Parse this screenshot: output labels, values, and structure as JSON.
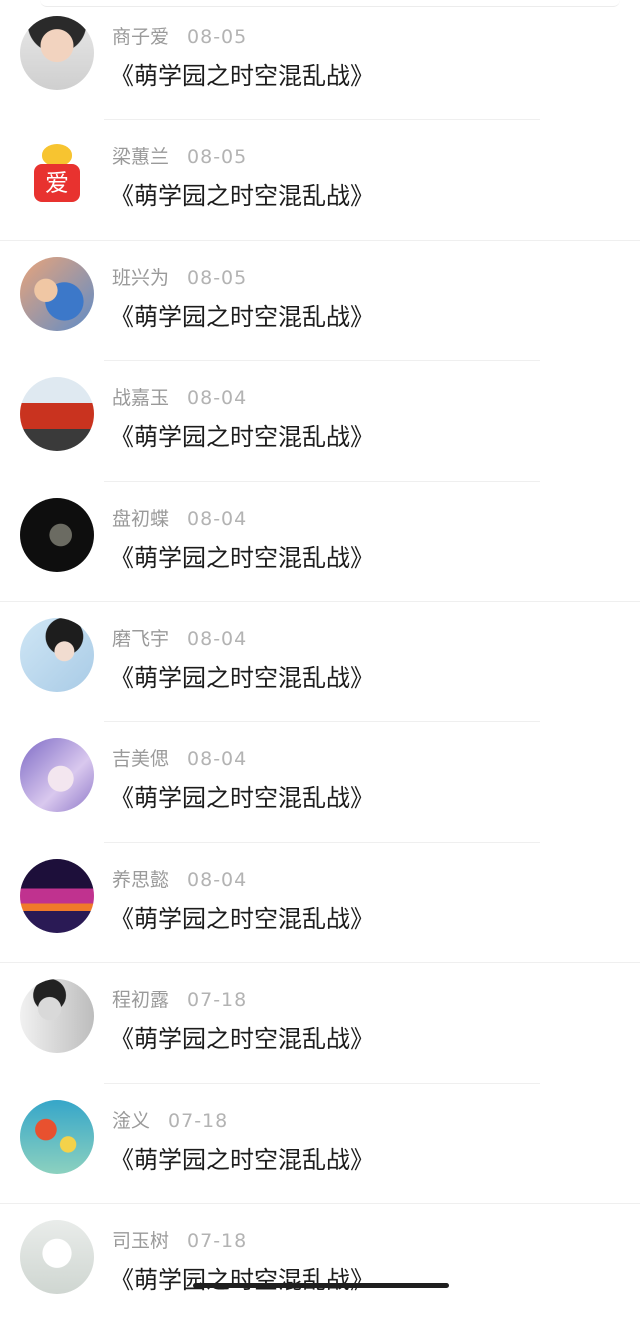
{
  "items": [
    {
      "name": "商子爱",
      "date": "08-05",
      "title": "《萌学园之时空混乱战》",
      "avatar_icon": "avatar-photo-icon"
    },
    {
      "name": "梁蕙兰",
      "date": "08-05",
      "title": "《萌学园之时空混乱战》",
      "avatar_icon": "love-mascot-icon",
      "avatar_text": "爱"
    },
    {
      "name": "班兴为",
      "date": "08-05",
      "title": "《萌学园之时空混乱战》",
      "avatar_icon": "avatar-photo-icon"
    },
    {
      "name": "战嘉玉",
      "date": "08-04",
      "title": "《萌学园之时空混乱战》",
      "avatar_icon": "fire-truck-icon"
    },
    {
      "name": "盘初蝶",
      "date": "08-04",
      "title": "《萌学园之时空混乱战》",
      "avatar_icon": "dinosaur-icon"
    },
    {
      "name": "磨飞宇",
      "date": "08-04",
      "title": "《萌学园之时空混乱战》",
      "avatar_icon": "avatar-photo-icon"
    },
    {
      "name": "吉美偲",
      "date": "08-04",
      "title": "《萌学园之时空混乱战》",
      "avatar_icon": "anime-girl-icon"
    },
    {
      "name": "养思懿",
      "date": "08-04",
      "title": "《萌学园之时空混乱战》",
      "avatar_icon": "city-night-icon"
    },
    {
      "name": "程初露",
      "date": "07-18",
      "title": "《萌学园之时空混乱战》",
      "avatar_icon": "avatar-photo-icon"
    },
    {
      "name": "淦义",
      "date": "07-18",
      "title": "《萌学园之时空混乱战》",
      "avatar_icon": "flowers-icon"
    },
    {
      "name": "司玉树",
      "date": "07-18",
      "title": "《萌学园之时空混乱战》",
      "avatar_icon": "sketch-figure-icon"
    }
  ],
  "colors": {
    "name_text": "#9a9a9a",
    "date_text": "#b3b3b3",
    "title_text": "#1c1c1c",
    "separator": "#efefef"
  }
}
